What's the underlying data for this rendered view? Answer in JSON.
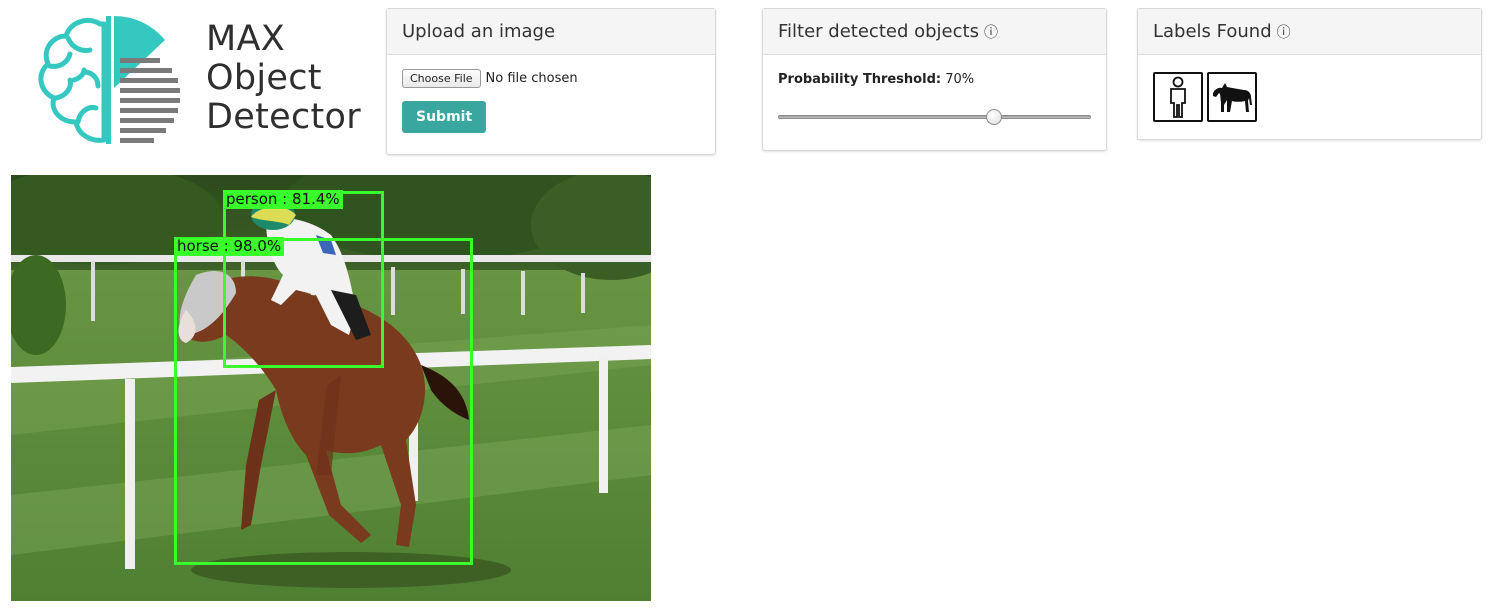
{
  "logo": {
    "line1": "MAX",
    "line2": "Object",
    "line3": "Detector"
  },
  "upload": {
    "title": "Upload an image",
    "choose_label": "Choose File",
    "file_status": "No file chosen",
    "submit_label": "Submit"
  },
  "filter": {
    "title": "Filter detected objects",
    "info_glyph": "ⓘ",
    "threshold_label": "Probability Threshold:",
    "threshold_value": "70%",
    "threshold_fraction": 0.7
  },
  "labels": {
    "title": "Labels Found",
    "info_glyph": "ⓘ",
    "icons": [
      "person-icon",
      "horse-icon"
    ]
  },
  "detections": [
    {
      "label": "person : 81.4%"
    },
    {
      "label": "horse : 98.0%"
    }
  ],
  "colors": {
    "accent": "#3aa6a0",
    "logo_teal": "#35c8c0",
    "bbox": "#39ff2a"
  }
}
